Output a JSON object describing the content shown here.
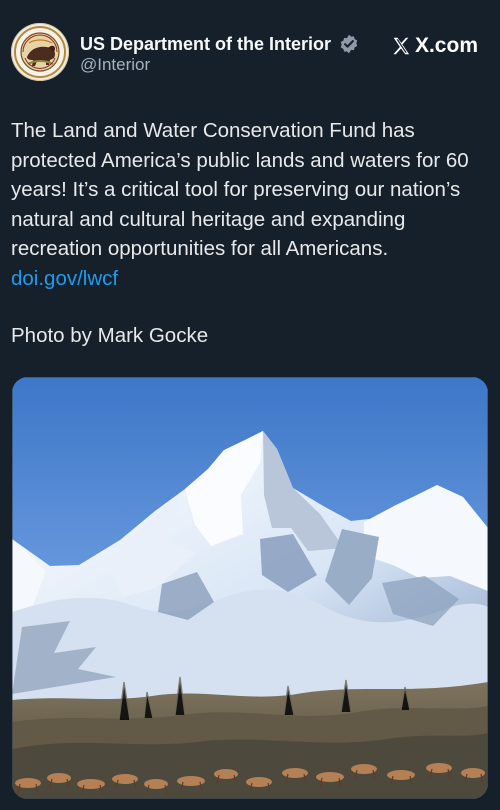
{
  "account": {
    "display_name": "US Department of the Interior",
    "handle": "@Interior",
    "avatar_icon": "interior-department-seal-icon",
    "verified_icon": "verified-badge-icon",
    "verified_color": "#8f9aa8"
  },
  "source": {
    "label": "X.com",
    "icon": "x-logo-icon"
  },
  "post": {
    "body": "The Land and Water Conservation Fund has protected America’s public lands and waters for 60 years! It’s a critical tool for preserving our nation’s natural and cultural heritage and expanding recreation opportunities for all Americans. ",
    "link_text": "doi.gov/lwcf",
    "photo_credit": "Photo by Mark Gocke"
  },
  "media": {
    "kind": "photo",
    "subject": "mountain-range-with-elk-herd-image"
  },
  "colors": {
    "background": "#15202b",
    "text": "#e7e9ea",
    "secondary_text": "#a7b2bf",
    "link": "#1d9bf0"
  }
}
